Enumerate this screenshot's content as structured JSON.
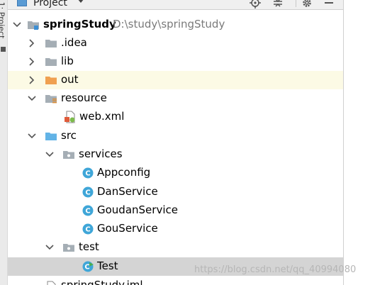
{
  "toolwindow": {
    "side_label": "1: Project"
  },
  "header": {
    "title": "Project",
    "actions": [
      "locate-icon",
      "collapse-all-icon",
      "settings-icon",
      "hide-icon"
    ]
  },
  "tree": {
    "root": {
      "label": "springStudy",
      "path": "D:\\study\\springStudy"
    },
    "idea": "idea",
    "idea_label": ".idea",
    "lib": "lib",
    "out": "out",
    "resource": "resource",
    "webxml": "web.xml",
    "src": "src",
    "services": "services",
    "appconfig": "Appconfig",
    "danservice": "DanService",
    "goudanservice": "GoudanService",
    "gouservice": "GouService",
    "test_pkg": "test",
    "test_class": "Test",
    "iml": "springStudy.iml"
  },
  "watermark": "https://blog.csdn.net/qq_40994080",
  "colors": {
    "folder": "#a5aeb5",
    "out_folder": "#f0a050",
    "src_folder": "#62b3e6",
    "class_icon": "#3fa6d8",
    "highlight_row": "#fcfae5",
    "selected_row": "#d4d4d4"
  }
}
